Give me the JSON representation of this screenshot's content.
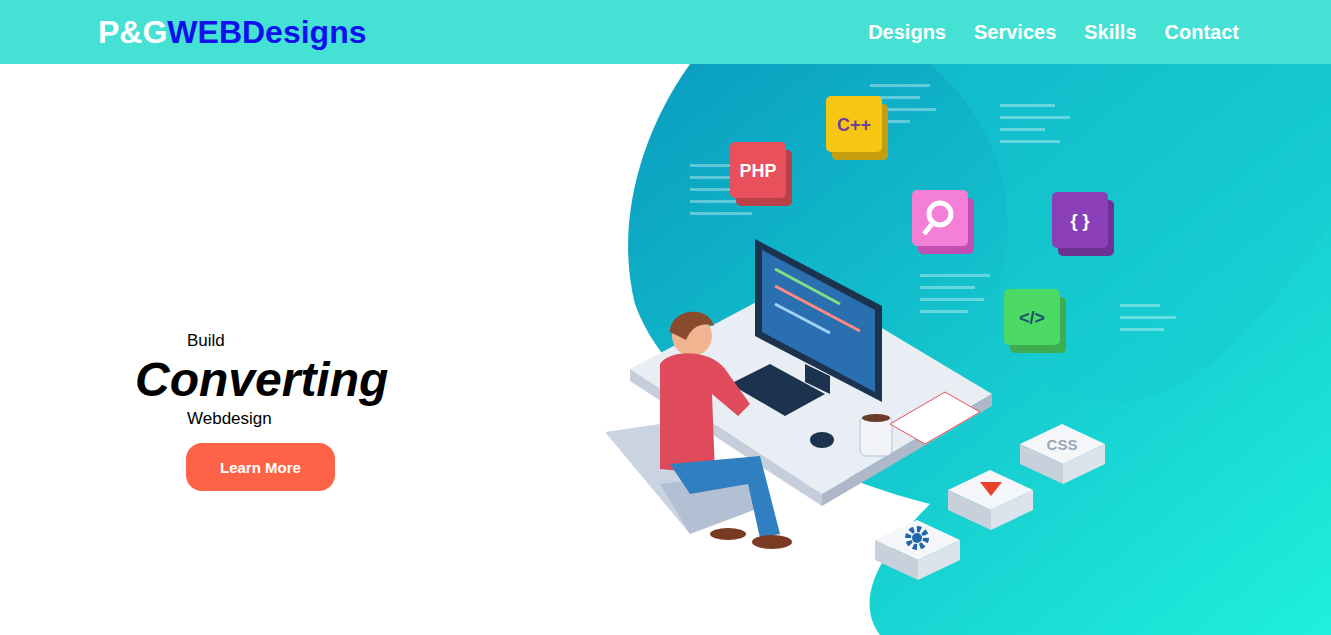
{
  "logo": {
    "first": "P&G",
    "second": "WEBDesigns"
  },
  "nav": [
    {
      "label": "Designs"
    },
    {
      "label": "Services"
    },
    {
      "label": "Skills"
    },
    {
      "label": "Contact"
    }
  ],
  "hero": {
    "kicker": "Build",
    "headline": "Converting",
    "tail": "Webdesign",
    "button": "Learn More"
  },
  "illustration": {
    "tiles": [
      {
        "label": "PHP",
        "color": "#e8505b"
      },
      {
        "label": "C++",
        "color": "#f7c613"
      },
      {
        "label": "{ }",
        "color": "#8a3fb8"
      },
      {
        "label": "</>",
        "color": "#4cd964"
      }
    ],
    "block_label": "CSS"
  }
}
